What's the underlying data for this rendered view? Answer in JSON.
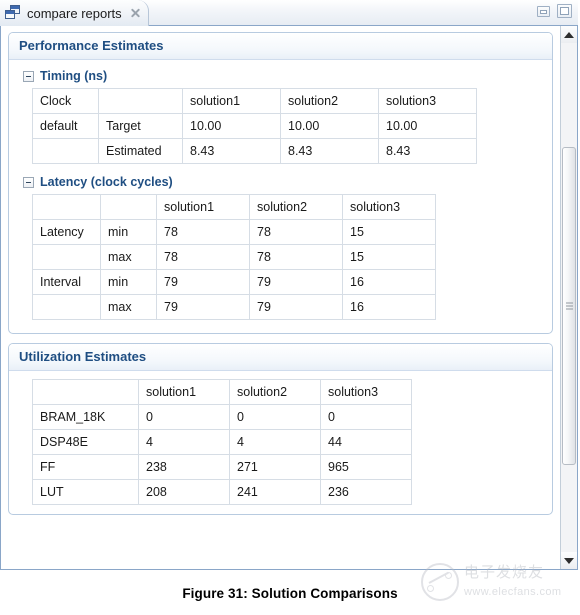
{
  "window": {
    "tab": {
      "icon": "compare-reports-icon",
      "title": "compare reports",
      "close_icon": "close-icon"
    },
    "controls": {
      "minimize_icon": "minimize-icon",
      "maximize_icon": "maximize-icon"
    },
    "scrollbar": {
      "up_icon": "scroll-up-arrow-icon",
      "down_icon": "scroll-down-arrow-icon"
    }
  },
  "performance": {
    "header": "Performance Estimates",
    "timing": {
      "toggle_icon": "collapse-minus-icon",
      "title": "Timing (ns)",
      "rows": [
        [
          "Clock",
          "",
          "solution1",
          "solution2",
          "solution3"
        ],
        [
          "default",
          "Target",
          "10.00",
          "10.00",
          "10.00"
        ],
        [
          "",
          "Estimated",
          "8.43",
          "8.43",
          "8.43"
        ]
      ]
    },
    "latency": {
      "toggle_icon": "collapse-minus-icon",
      "title": "Latency (clock cycles)",
      "rows": [
        [
          "",
          "",
          "solution1",
          "solution2",
          "solution3"
        ],
        [
          "Latency",
          "min",
          "78",
          "78",
          "15"
        ],
        [
          "",
          "max",
          "78",
          "78",
          "15"
        ],
        [
          "Interval",
          "min",
          "79",
          "79",
          "16"
        ],
        [
          "",
          "max",
          "79",
          "79",
          "16"
        ]
      ]
    }
  },
  "utilization": {
    "header": "Utilization Estimates",
    "rows": [
      [
        "",
        "solution1",
        "solution2",
        "solution3"
      ],
      [
        "BRAM_18K",
        "0",
        "0",
        "0"
      ],
      [
        "DSP48E",
        "4",
        "4",
        "44"
      ],
      [
        "FF",
        "238",
        "271",
        "965"
      ],
      [
        "LUT",
        "208",
        "241",
        "236"
      ]
    ]
  },
  "caption": "Figure 31:  Solution Comparisons",
  "watermark": {
    "logo_icon": "elecfans-logo-icon",
    "cn_text": "电子发烧友",
    "url_text": "www.elecfans.com"
  },
  "colors": {
    "accent": "#1f4e82",
    "panel_border": "#b8cbe0",
    "table_border": "#d6dde5",
    "window_border": "#8aa6c8"
  }
}
